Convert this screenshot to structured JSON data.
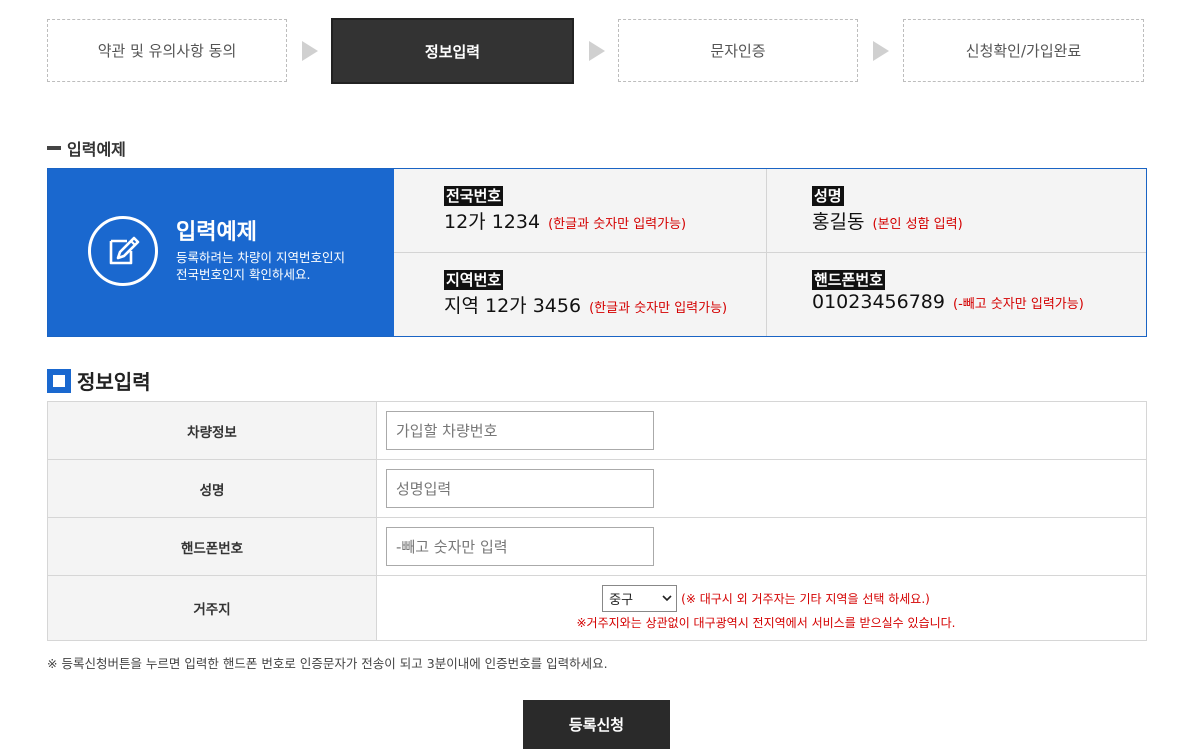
{
  "steps": [
    {
      "label": "약관 및 유의사항 동의",
      "active": false
    },
    {
      "label": "정보입력",
      "active": true
    },
    {
      "label": "문자인증",
      "active": false
    },
    {
      "label": "신청확인/가입완료",
      "active": false
    }
  ],
  "example_heading": "입력예제",
  "example": {
    "icon": "pencil-edit-icon",
    "title": "입력예제",
    "desc_line1": "등록하려는 차량이 지역번호인지",
    "desc_line2": "전국번호인지 확인하세요.",
    "cells": [
      {
        "label": "전국번호",
        "value": "12가 1234",
        "note": "(한글과 숫자만 입력가능)"
      },
      {
        "label": "성명",
        "value": "홍길동",
        "note": "(본인 성함 입력)"
      },
      {
        "label": "지역번호",
        "value": "지역 12가 3456",
        "note": "(한글과 숫자만 입력가능)"
      },
      {
        "label": "핸드폰번호",
        "value": "01023456789",
        "note": "(-빼고 숫자만 입력가능)"
      }
    ]
  },
  "form_heading": "정보입력",
  "form": {
    "vehicle_label": "차량정보",
    "vehicle_placeholder": "가입할 차량번호",
    "name_label": "성명",
    "name_placeholder": "성명입력",
    "phone_label": "핸드폰번호",
    "phone_placeholder": "-빼고 숫자만 입력",
    "address_label": "거주지",
    "address_selected": "중구",
    "address_note1": "(※ 대구시 외 거주자는 기타 지역을 선택 하세요.)",
    "address_note2": "※거주지와는 상관없이 대구광역시 전지역에서 서비스를 받으실수 있습니다."
  },
  "notice": "※ 등록신청버튼을 누르면 입력한 핸드폰 번호로 인증문자가 전송이 되고 3분이내에 인증번호를 입력하세요.",
  "submit_label": "등록신청",
  "colors": {
    "accent": "#1a68cf",
    "dark": "#333333",
    "note_red": "#d40000"
  }
}
